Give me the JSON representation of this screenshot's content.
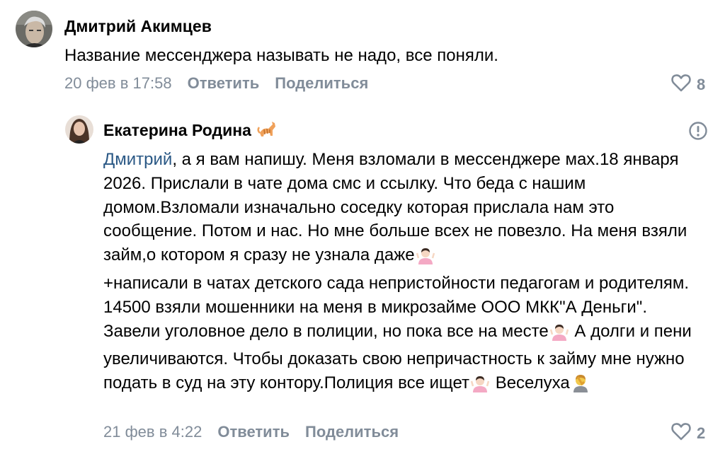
{
  "comments": [
    {
      "author": "Дмитрий Акимцев",
      "text": "Название мессенджера называть не надо, все поняли.",
      "date": "20 фев в 17:58",
      "reply_label": "Ответить",
      "share_label": "Поделиться",
      "likes": "8"
    },
    {
      "author": "Екатерина Родина",
      "author_emoji": "cat-emoji",
      "mention": "Дмитрий",
      "text_p1": ", а я вам напишу. Меня взломали в мессенджере мах.18 января 2026. Прислали в чате дома смс и ссылку. Что беда с нашим домом.Взломали изначально соседку которая прислала нам это сообщение. Потом и нас. Но мне больше всех не повезло. На меня взяли займ,о котором я сразу не узнала даже",
      "text_p2": "+написали в чатах детского сада непристойности педагогам и родителям. 14500 взяли мошенники на меня в микрозайме ООО МКК\"А Деньги\". Завели уголовное дело в полиции, но пока все на месте",
      "text_p3": " А долги и пени увеличиваются. Чтобы доказать свою непричастность к займу мне нужно подать в суд на эту контору.Полиция все ищет",
      "text_p4": " Веселуха",
      "date": "21 фев в 4:22",
      "reply_label": "Ответить",
      "share_label": "Поделиться",
      "likes": "2"
    }
  ],
  "colors": {
    "muted": "#818c99",
    "mention": "#2a5885",
    "text": "#000000"
  },
  "icons": [
    "heart-icon",
    "report-icon",
    "cat-emoji",
    "shrug-woman-emoji",
    "facepalm-emoji"
  ]
}
